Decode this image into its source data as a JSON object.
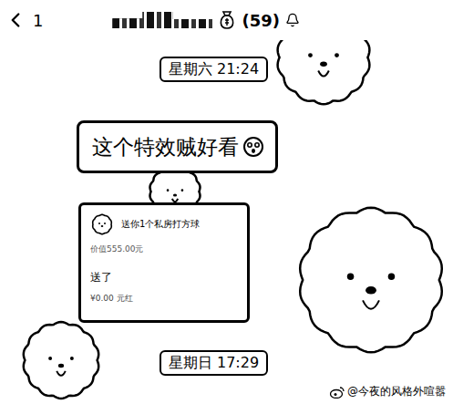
{
  "header": {
    "unread": "1",
    "count": "(59)"
  },
  "messages": [
    {
      "kind": "time",
      "text": "星期六 21:24"
    },
    {
      "kind": "text",
      "text": "这个特效贼好看"
    },
    {
      "kind": "gift",
      "title": "送你1个私房打方球",
      "subtitle": "价值555.00元",
      "status": "送了",
      "amount": "¥0.00 元红"
    },
    {
      "kind": "time",
      "text": "星期日 17:29"
    }
  ],
  "watermark": "@今夜的风格外喧嚣"
}
